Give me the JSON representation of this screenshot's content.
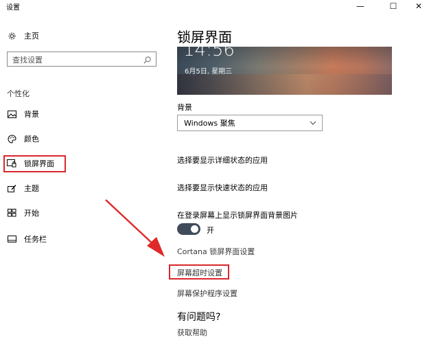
{
  "window": {
    "title": "设置",
    "minimize": "—",
    "maximize": "☐",
    "close": "✕"
  },
  "sidebar": {
    "home": "主页",
    "search_placeholder": "查找设置",
    "section": "个性化",
    "items": [
      {
        "label": "背景",
        "icon": "image-icon"
      },
      {
        "label": "颜色",
        "icon": "palette-icon"
      },
      {
        "label": "锁屏界面",
        "icon": "lock-screen-icon"
      },
      {
        "label": "主题",
        "icon": "theme-icon"
      },
      {
        "label": "开始",
        "icon": "start-icon"
      },
      {
        "label": "任务栏",
        "icon": "taskbar-icon"
      }
    ]
  },
  "main": {
    "title": "锁屏界面",
    "preview": {
      "time": "14:56",
      "date": "6月5日, 星期三"
    },
    "background_label": "背景",
    "background_value": "Windows 聚焦",
    "detail_apps": "选择要显示详细状态的应用",
    "quick_apps": "选择要显示快速状态的应用",
    "show_bg_on_login": "在登录屏幕上显示锁屏界面背景图片",
    "toggle_state": "开",
    "cortana_link": "Cortana 锁屏界面设置",
    "timeout_link": "屏幕超时设置",
    "screensaver_link": "屏幕保护程序设置",
    "faq_title": "有问题吗?",
    "help_link": "获取帮助"
  },
  "colors": {
    "highlight": "#d9262c",
    "toggle_on": "#3f4b59"
  }
}
